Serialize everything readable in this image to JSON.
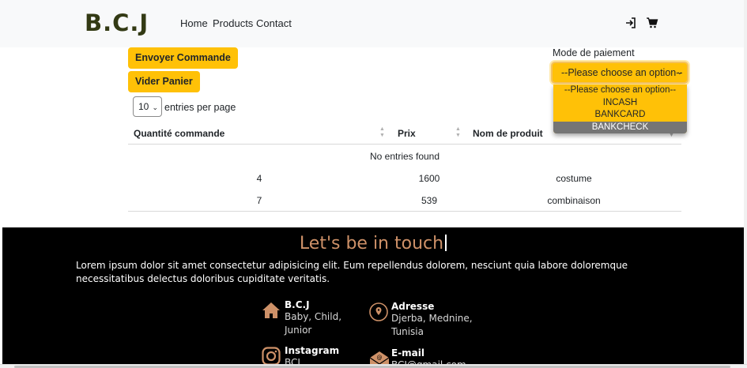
{
  "navbar": {
    "brand": "B.C.J",
    "links": [
      "Home",
      "Products",
      "Contact"
    ],
    "icons": [
      "login-icon",
      "cart-icon"
    ]
  },
  "actions": {
    "send_order": "Envoyer Commande",
    "empty_cart": "Vider Panier"
  },
  "datatable": {
    "page_size": "10",
    "entries_label": "entries per page",
    "columns": [
      "Quantité commande",
      "Prix",
      "Nom de produit"
    ],
    "empty_message": "No entries found",
    "rows": [
      {
        "quantity": "4",
        "price": "1600",
        "product": "costume"
      },
      {
        "quantity": "7",
        "price": "539",
        "product": "combinaison"
      }
    ]
  },
  "payment": {
    "label": "Mode de paiement",
    "selected": "--Please choose an option--",
    "options": [
      "--Please choose an option--",
      "INCASH",
      "BANKCARD",
      "BANKCHECK"
    ],
    "highlighted": "BANKCHECK"
  },
  "footer": {
    "title": "Let's be in touch",
    "text": "Lorem ipsum dolor sit amet consectetur adipisicing elit. Eum repellendus dolorem, nesciunt quia labore doloremque necessitatibus delectus doloribus cupiditate veritatis.",
    "contacts": {
      "brand": {
        "title": "B.C.J",
        "lines": [
          "Baby, Child,",
          "Junior"
        ],
        "icon": "home-icon"
      },
      "address": {
        "title": "Adresse",
        "lines": [
          "Djerba, Mednine,",
          "Tunisia"
        ],
        "icon": "location-icon"
      },
      "instagram": {
        "title": "Instagram",
        "lines": [
          "BCJ"
        ],
        "icon": "instagram-icon"
      },
      "email": {
        "title": "E-mail",
        "lines": [
          "BCJ@gmail.com"
        ],
        "icon": "mail-icon"
      }
    }
  },
  "colors": {
    "accent": "#ffc107",
    "footer_bg": "#000000",
    "footer_title": "#ce9168",
    "brand": "#333a14"
  }
}
